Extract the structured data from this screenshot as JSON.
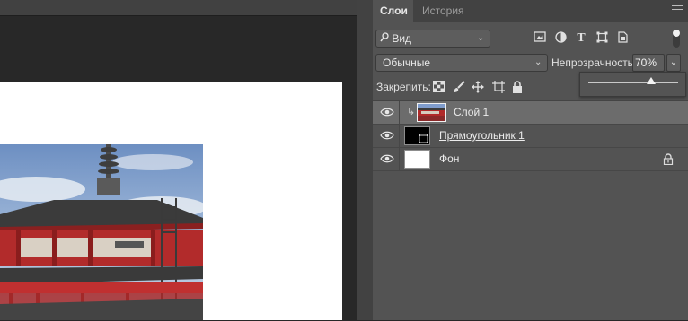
{
  "panel": {
    "tabs": [
      {
        "label": "Слои",
        "active": true
      },
      {
        "label": "История",
        "active": false
      }
    ],
    "menu_icon": "hamburger-menu-icon"
  },
  "filter": {
    "kind_icon": "search-icon",
    "kind_value": "Вид",
    "filter_icons": [
      "image-filter-icon",
      "adjustment-filter-icon",
      "type-filter-icon",
      "shape-filter-icon",
      "smart-object-filter-icon"
    ],
    "filter_toggle_on": true
  },
  "blend": {
    "mode_value": "Обычные",
    "opacity_label": "Непрозрачность:",
    "opacity_value": "70%",
    "opacity_slider_level": 0.7
  },
  "lock": {
    "label": "Закрепить:",
    "icons": [
      "lock-transparent-pixels-icon",
      "lock-image-pixels-icon",
      "lock-position-icon",
      "lock-artboard-icon",
      "lock-all-icon"
    ]
  },
  "layers": [
    {
      "name": "Слой 1",
      "selected": true,
      "visible": true,
      "clipped": true,
      "thumbnail": "photo",
      "locked": false
    },
    {
      "name": "Прямоугольник 1",
      "selected": false,
      "visible": true,
      "clipped": false,
      "thumbnail": "shape",
      "locked": false
    },
    {
      "name": "Фон",
      "selected": false,
      "visible": true,
      "clipped": false,
      "thumbnail": "white",
      "locked": true
    }
  ],
  "colors": {
    "panel_bg": "#535353",
    "selected_layer_bg": "#6c6c6c",
    "workspace_bg": "#282828"
  }
}
